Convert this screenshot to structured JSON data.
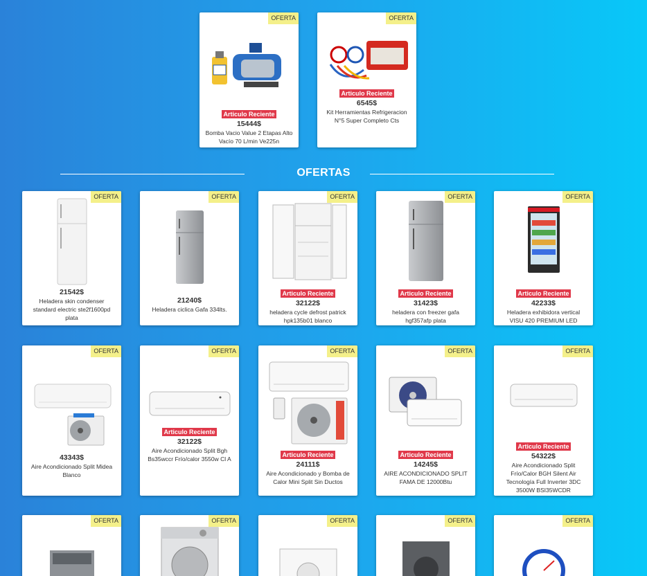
{
  "badge_label": "OFERTA",
  "recent_label": "Articulo Reciente",
  "section_title": "OFERTAS",
  "featured": [
    {
      "price": "15444$",
      "name": "Bomba Vacio Value 2 Etapas Alto Vacío 70 L/min Ve225n",
      "recent": true,
      "icon": "vacuum-pump"
    },
    {
      "price": "6545$",
      "name": "Kit Herramientas Refrigeracion N°5 Super Completo Cts",
      "recent": true,
      "icon": "tool-kit"
    }
  ],
  "offers_row1": [
    {
      "price": "21542$",
      "name": "Heladera skin condenser standard electric ste2f1600pd plata",
      "recent": false,
      "icon": "fridge-white"
    },
    {
      "price": "21240$",
      "name": "Heladera ciclica Gafa 334lts.",
      "recent": false,
      "icon": "fridge-silver"
    },
    {
      "price": "32122$",
      "name": "heladera cycle defrost patrick hpk135b01 blanco",
      "recent": true,
      "icon": "fridge-open"
    },
    {
      "price": "31423$",
      "name": "heladera con freezer gafa hgf357afp plata",
      "recent": true,
      "icon": "fridge-silver"
    },
    {
      "price": "42233$",
      "name": "Heladera exhibidora vertical VISU 420 PREMIUM LED",
      "recent": true,
      "icon": "display-fridge"
    }
  ],
  "offers_row2": [
    {
      "price": "43343$",
      "name": "Aire Acondicionado Split Midea Blanco",
      "recent": false,
      "icon": "split-ac"
    },
    {
      "price": "32122$",
      "name": "Aire Acondicionado Split Bgh Bs35wccr Frío/calor 3550w Cl A",
      "recent": true,
      "icon": "split-indoor"
    },
    {
      "price": "24111$",
      "name": "Aire Acondicionado y Bomba de Calor Mini Split Sin Ductos",
      "recent": true,
      "icon": "split-ac"
    },
    {
      "price": "14245$",
      "name": "AIRE ACONDICIONADO SPLIT FAMA DE 12000Btu",
      "recent": true,
      "icon": "split-ac"
    },
    {
      "price": "54322$",
      "name": "Aire Acondicionado Split Frío/Calor BGH Silent Air Tecnología Full Inverter 3DC 3500W BSI35WCDR",
      "recent": true,
      "icon": "split-indoor"
    }
  ],
  "offers_row3": [
    {
      "icon": "washer-top"
    },
    {
      "icon": "washer-front"
    },
    {
      "icon": "washer-front"
    },
    {
      "icon": "washer-dark"
    },
    {
      "icon": "gauge"
    }
  ],
  "colors": {
    "badge": "#f4f08a",
    "recent": "#e0394a",
    "bg_left": "#2a82d9",
    "bg_right": "#08c8f8"
  }
}
